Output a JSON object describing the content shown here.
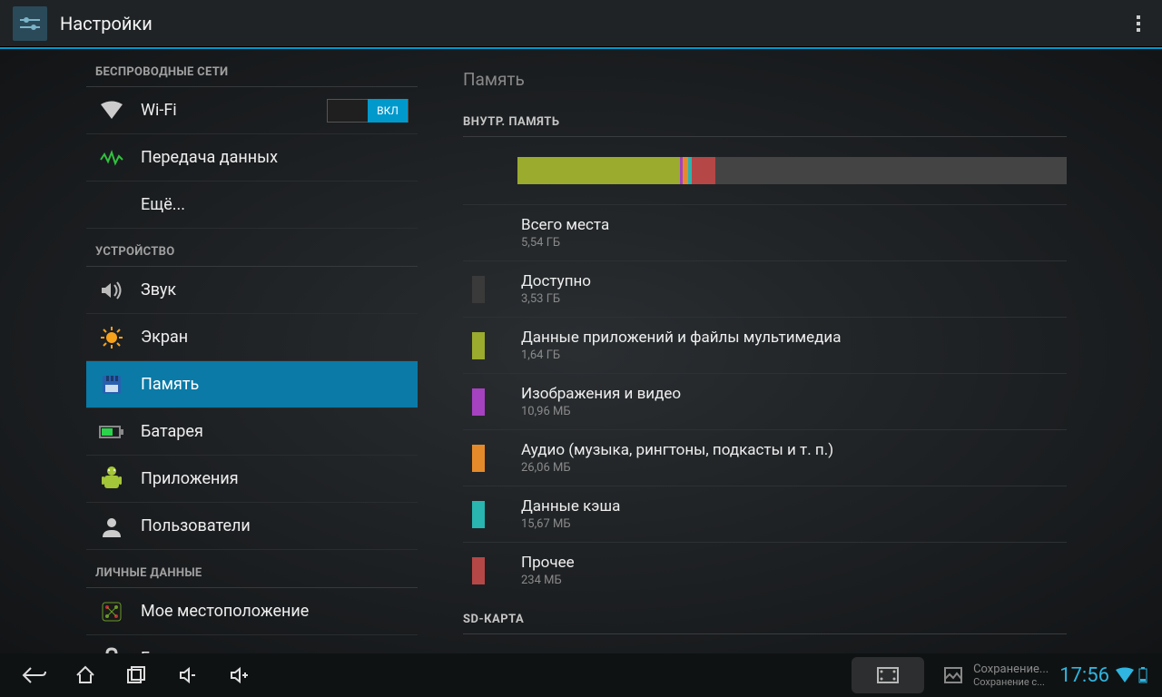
{
  "actionbar": {
    "title": "Настройки"
  },
  "sidebar": {
    "sections": [
      {
        "header": "Беспроводные сети",
        "items": [
          {
            "label": "Wi-Fi",
            "toggle": "ВКЛ",
            "icon": "wifi"
          },
          {
            "label": "Передача данных",
            "icon": "data"
          },
          {
            "label": "Ещё...",
            "icon": "none"
          }
        ]
      },
      {
        "header": "Устройство",
        "items": [
          {
            "label": "Звук",
            "icon": "sound"
          },
          {
            "label": "Экран",
            "icon": "display"
          },
          {
            "label": "Память",
            "icon": "storage",
            "selected": true
          },
          {
            "label": "Батарея",
            "icon": "battery"
          },
          {
            "label": "Приложения",
            "icon": "apps"
          },
          {
            "label": "Пользователи",
            "icon": "users"
          }
        ]
      },
      {
        "header": "Личные данные",
        "items": [
          {
            "label": "Мое местоположение",
            "icon": "location"
          },
          {
            "label": "Безопасность",
            "icon": "security"
          }
        ]
      }
    ]
  },
  "detail": {
    "title": "Память",
    "internal_header": "ВНУТР. ПАМЯТЬ",
    "sd_header": "SD-КАРТА",
    "bar": [
      {
        "color": "#9aab2e",
        "pct": 29.6
      },
      {
        "color": "#a542c0",
        "pct": 0.5
      },
      {
        "color": "#e58a2a",
        "pct": 0.9
      },
      {
        "color": "#29b5b0",
        "pct": 0.8
      },
      {
        "color": "#b54747",
        "pct": 4.2
      }
    ],
    "rows": [
      {
        "title": "Всего места",
        "sub": "5,54 ГБ",
        "swatch": ""
      },
      {
        "title": "Доступно",
        "sub": "3,53 ГБ",
        "swatch": "#3a3a3a"
      },
      {
        "title": "Данные приложений и файлы мультимедиа",
        "sub": "1,64 ГБ",
        "swatch": "#9aab2e"
      },
      {
        "title": "Изображения и видео",
        "sub": "10,96 МБ",
        "swatch": "#a542c0"
      },
      {
        "title": "Аудио (музыка, рингтоны, подкасты и т. п.)",
        "sub": "26,06 МБ",
        "swatch": "#e58a2a"
      },
      {
        "title": "Данные кэша",
        "sub": "15,67 МБ",
        "swatch": "#29b5b0"
      },
      {
        "title": "Прочее",
        "sub": "234 МБ",
        "swatch": "#b54747"
      }
    ]
  },
  "navbar": {
    "notif_title": "Сохранение...",
    "notif_sub": "Сохранение с...",
    "clock": "17:56"
  }
}
